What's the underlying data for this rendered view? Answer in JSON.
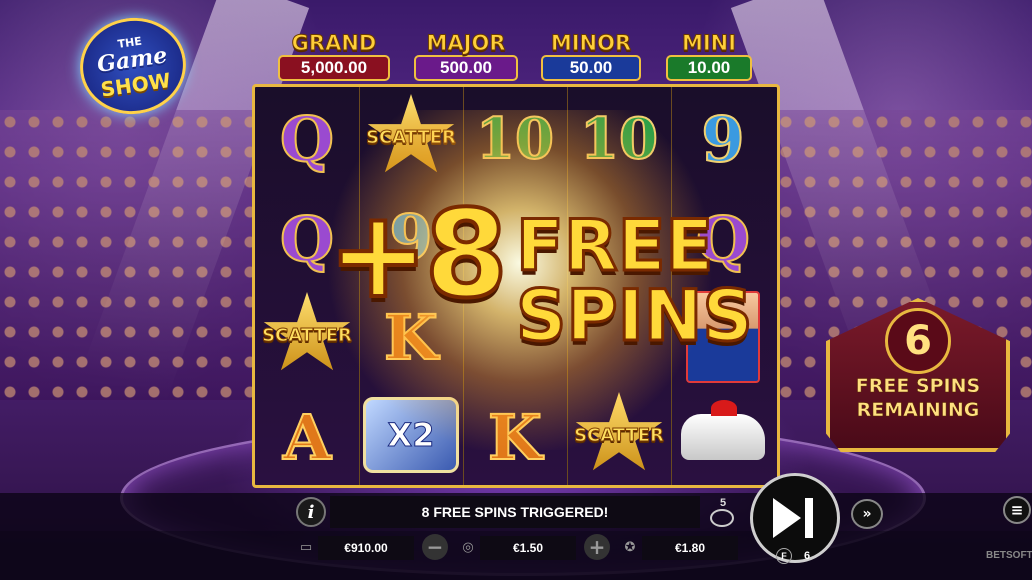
{
  "logo": {
    "line1": "THE",
    "line2": "Game",
    "line3": "SHOW"
  },
  "jackpots": [
    {
      "name": "GRAND",
      "value": "5,000.00",
      "color": "#8a1020"
    },
    {
      "name": "MAJOR",
      "value": "500.00",
      "color": "#6a1a8a"
    },
    {
      "name": "MINOR",
      "value": "50.00",
      "color": "#1a3a9a"
    },
    {
      "name": "MINI",
      "value": "10.00",
      "color": "#1a7a2a"
    }
  ],
  "reels": {
    "scatter_label": "SCATTER",
    "multiplier_label": "X2",
    "symbols": [
      [
        "Q",
        "Q",
        "scatter",
        "A"
      ],
      [
        "scatter",
        "9",
        "K",
        "x2"
      ],
      [
        "10",
        "",
        "",
        "K"
      ],
      [
        "10",
        "",
        "",
        "scatter"
      ],
      [
        "9",
        "Q",
        "host",
        "car"
      ]
    ]
  },
  "overlay": {
    "plus": "+8",
    "line1": "FREE",
    "line2": "SPINS"
  },
  "remaining": {
    "count": "6",
    "line1": "FREE SPINS",
    "line2": "REMAINING"
  },
  "bottom": {
    "message": "8 FREE SPINS TRIGGERED!",
    "balance": "€910.00",
    "bet": "€1.50",
    "win": "€1.80",
    "autoplay_count": "5",
    "free_spins_count": "6",
    "free_spins_badge": "F",
    "brand": "BETSOFT",
    "info_label": "i"
  },
  "colors": {
    "gold": "#e8b840",
    "text_gold": "#ffd93a",
    "bg": "#3a1a6a"
  }
}
